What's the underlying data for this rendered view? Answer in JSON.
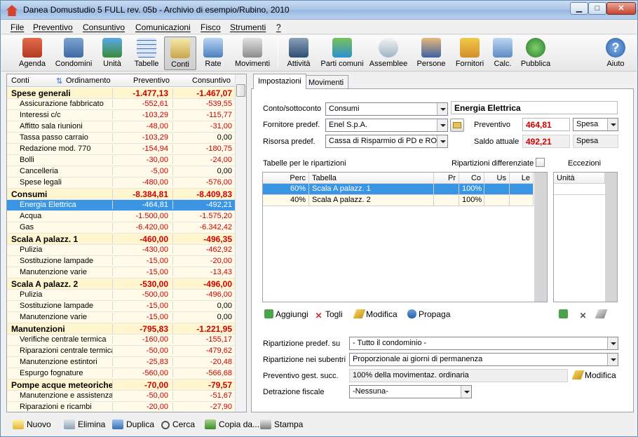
{
  "window": {
    "title": "Danea Domustudio 5 FULL rev. 05b - Archivio di esempio/Rubino, 2010"
  },
  "menu": [
    "File",
    "Preventivo",
    "Consuntivo",
    "Comunicazioni",
    "Fisco",
    "Strumenti",
    "?"
  ],
  "toolbar": {
    "agenda": "Agenda",
    "condomini": "Condomini",
    "unita": "Unità",
    "tabelle": "Tabelle",
    "conti": "Conti",
    "rate": "Rate",
    "movimenti": "Movimenti",
    "attivita": "Attività",
    "parti_comuni": "Parti comuni",
    "assemblee": "Assemblee",
    "persone": "Persone",
    "fornitori": "Fornitori",
    "calc": "Calc.",
    "pubblica": "Pubblica",
    "aiuto": "Aiuto"
  },
  "colors": {
    "selection": "#3a96e4",
    "negative": "#d00000",
    "group_row": "#fff6d0",
    "row": "#fffbe8"
  },
  "accounts": {
    "headers": {
      "conti": "Conti",
      "ordinamento": "Ordinamento",
      "preventivo": "Preventivo",
      "consuntivo": "Consuntivo"
    },
    "rows": [
      {
        "name": "Spese generali",
        "prev": "-1.477,13",
        "cons": "-1.467,07",
        "group": true
      },
      {
        "name": "Assicurazione fabbricato",
        "prev": "-552,61",
        "cons": "-539,55"
      },
      {
        "name": "Interessi c/c",
        "prev": "-103,29",
        "cons": "-115,77"
      },
      {
        "name": "Affitto sala riunioni",
        "prev": "-48,00",
        "cons": "-31,00"
      },
      {
        "name": "Tassa passo carraio",
        "prev": "-103,29",
        "cons": "0,00"
      },
      {
        "name": "Redazione mod. 770",
        "prev": "-154,94",
        "cons": "-180,75"
      },
      {
        "name": "Bolli",
        "prev": "-30,00",
        "cons": "-24,00"
      },
      {
        "name": "Cancelleria",
        "prev": "-5,00",
        "cons": "0,00"
      },
      {
        "name": "Spese legali",
        "prev": "-480,00",
        "cons": "-576,00"
      },
      {
        "name": "Consumi",
        "prev": "-8.384,81",
        "cons": "-8.409,83",
        "group": true
      },
      {
        "name": "Energia Elettrica",
        "prev": "-464,81",
        "cons": "-492,21",
        "selected": true
      },
      {
        "name": "Acqua",
        "prev": "-1.500,00",
        "cons": "-1.575,20"
      },
      {
        "name": "Gas",
        "prev": "-6.420,00",
        "cons": "-6.342,42"
      },
      {
        "name": "Scala A palazz. 1",
        "prev": "-460,00",
        "cons": "-496,35",
        "group": true
      },
      {
        "name": "Pulizia",
        "prev": "-430,00",
        "cons": "-462,92"
      },
      {
        "name": "Sostituzione lampade",
        "prev": "-15,00",
        "cons": "-20,00"
      },
      {
        "name": "Manutenzione varie",
        "prev": "-15,00",
        "cons": "-13,43"
      },
      {
        "name": "Scala A palazz. 2",
        "prev": "-530,00",
        "cons": "-496,00",
        "group": true
      },
      {
        "name": "Pulizia",
        "prev": "-500,00",
        "cons": "-496,00"
      },
      {
        "name": "Sostituzione lampade",
        "prev": "-15,00",
        "cons": "0,00"
      },
      {
        "name": "Manutenzione varie",
        "prev": "-15,00",
        "cons": "0,00"
      },
      {
        "name": "Manutenzioni",
        "prev": "-795,83",
        "cons": "-1.221,95",
        "group": true
      },
      {
        "name": "Verifiche centrale termica",
        "prev": "-160,00",
        "cons": "-155,17"
      },
      {
        "name": "Riparazioni centrale termica",
        "prev": "-50,00",
        "cons": "-479,62"
      },
      {
        "name": "Manutenzione estintori",
        "prev": "-25,83",
        "cons": "-20,48"
      },
      {
        "name": "Espurgo fognature",
        "prev": "-560,00",
        "cons": "-566,68"
      },
      {
        "name": "Pompe acque meteoriche",
        "prev": "-70,00",
        "cons": "-79,57",
        "group": true
      },
      {
        "name": "Manutenzione e assistenza",
        "prev": "-50,00",
        "cons": "-51,67"
      },
      {
        "name": "Riparazioni e ricambi",
        "prev": "-20,00",
        "cons": "-27,90"
      }
    ]
  },
  "tabs": {
    "impostazioni": "Impostazioni",
    "movimenti": "Movimenti"
  },
  "form": {
    "conto_label": "Conto/sottoconto",
    "conto_value": "Consumi",
    "conto_name": "Energia Elettrica",
    "fornitore_label": "Fornitore predef.",
    "fornitore_value": "Enel S.p.A.",
    "preventivo_label": "Preventivo",
    "preventivo_value": "464,81",
    "tipo_value": "Spesa",
    "risorsa_label": "Risorsa predef.",
    "risorsa_value": "Cassa di Risparmio di PD e RO",
    "saldo_label": "Saldo attuale",
    "saldo_value": "492,21",
    "saldo_tipo": "Spesa",
    "tabelle_label": "Tabelle per le ripartizioni",
    "ripdiff_label": "Ripartizioni differenziate",
    "eccezioni_label": "Eccezioni",
    "grid_headers": {
      "perc": "Perc",
      "tabella": "Tabella",
      "pr": "Pr",
      "co": "Co",
      "us": "Us",
      "le": "Le"
    },
    "grid_rows": [
      {
        "perc": "60%",
        "tabella": "Scala A palazz. 1",
        "co": "100%"
      },
      {
        "perc": "40%",
        "tabella": "Scala A palazz. 2",
        "co": "100%"
      }
    ],
    "exc_header": "Unità",
    "aggiungi": "Aggiungi",
    "togli": "Togli",
    "modifica": "Modifica",
    "propaga": "Propaga",
    "rip_predef_label": "Ripartizione predef. su",
    "rip_predef_value": "- Tutto il condominio -",
    "rip_subentri_label": "Ripartizione nei subentri",
    "rip_subentri_value": "Proporzionale ai giorni di permanenza",
    "prev_succ_label": "Preventivo gest. succ.",
    "prev_succ_value": "100% della movimentaz. ordinaria",
    "modifica2": "Modifica",
    "detrazione_label": "Detrazione fiscale",
    "detrazione_value": "-Nessuna-"
  },
  "bottom": {
    "nuovo": "Nuovo",
    "elimina": "Elimina",
    "duplica": "Duplica",
    "cerca": "Cerca",
    "copia": "Copia da...",
    "stampa": "Stampa"
  }
}
